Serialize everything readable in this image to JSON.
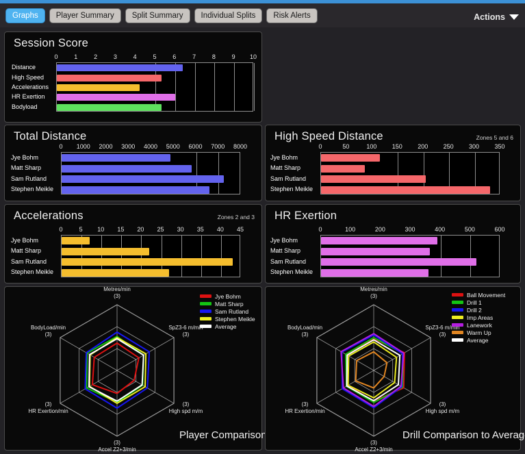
{
  "topbar": {
    "tabs": [
      {
        "label": "Graphs",
        "active": true
      },
      {
        "label": "Player Summary",
        "active": false
      },
      {
        "label": "Split Summary",
        "active": false
      },
      {
        "label": "Individual Splits",
        "active": false
      },
      {
        "label": "Risk Alerts",
        "active": false
      }
    ],
    "actions_label": "Actions",
    "caret_icon": "chevron-down-icon",
    "accent_color": "#4fb3f0",
    "strip_color": "#3c91d6"
  },
  "chart_data": [
    {
      "id": "session-score",
      "type": "bar",
      "orientation": "horizontal",
      "title": "Session Score",
      "subtitle": "",
      "categories": [
        "Distance",
        "High Speed",
        "Accelerations",
        "HR Exertion",
        "Bodyload"
      ],
      "values": [
        6.4,
        5.3,
        4.2,
        6.0,
        5.3
      ],
      "colors": [
        "#6363ee",
        "#f5676a",
        "#f5be2e",
        "#e06fe8",
        "#5ee05e"
      ],
      "xlim": [
        0,
        10
      ],
      "ticks": [
        0,
        1,
        2,
        3,
        4,
        5,
        6,
        7,
        8,
        9,
        10
      ],
      "gridlines": [
        5,
        6,
        7,
        8,
        9,
        10
      ],
      "xlabel": "",
      "ylabel": "",
      "grid": true,
      "legend": "none"
    },
    {
      "id": "total-distance",
      "type": "bar",
      "orientation": "horizontal",
      "title": "Total Distance",
      "subtitle": "",
      "categories": [
        "Jye Bohm",
        "Matt Sharp",
        "Sam Rutland",
        "Stephen Meikle"
      ],
      "values": [
        4850,
        5800,
        7250,
        6600
      ],
      "color": "#6363ee",
      "xlim": [
        0,
        8000
      ],
      "ticks": [
        0,
        1000,
        2000,
        3000,
        4000,
        5000,
        6000,
        7000,
        8000
      ],
      "gridlines": [
        6000,
        7000
      ],
      "xlabel": "",
      "ylabel": "",
      "grid": true,
      "legend": "none"
    },
    {
      "id": "high-speed-distance",
      "type": "bar",
      "orientation": "horizontal",
      "title": "High Speed Distance",
      "subtitle": "Zones 5 and 6",
      "categories": [
        "Jye Bohm",
        "Matt Sharp",
        "Sam Rutland",
        "Stephen Meikle"
      ],
      "values": [
        115,
        85,
        205,
        330
      ],
      "color": "#f5676a",
      "xlim": [
        0,
        350
      ],
      "ticks": [
        0,
        50,
        100,
        150,
        200,
        250,
        300,
        350
      ],
      "gridlines": [
        150,
        200,
        250,
        300
      ],
      "xlabel": "",
      "ylabel": "",
      "grid": true,
      "legend": "none"
    },
    {
      "id": "accelerations",
      "type": "bar",
      "orientation": "horizontal",
      "title": "Accelerations",
      "subtitle": "Zones 2 and 3",
      "categories": [
        "Jye Bohm",
        "Matt Sharp",
        "Sam Rutland",
        "Stephen Meikle"
      ],
      "values": [
        7,
        22,
        43,
        27
      ],
      "color": "#f5be2e",
      "xlim": [
        0,
        45
      ],
      "ticks": [
        0,
        5,
        10,
        15,
        20,
        25,
        30,
        35,
        40,
        45
      ],
      "gridlines": [
        5,
        10,
        15,
        20,
        25,
        30,
        35,
        40
      ],
      "xlabel": "",
      "ylabel": "",
      "grid": true,
      "legend": "none"
    },
    {
      "id": "hr-exertion",
      "type": "bar",
      "orientation": "horizontal",
      "title": "HR Exertion",
      "subtitle": "",
      "categories": [
        "Jye Bohm",
        "Matt Sharp",
        "Sam Rutland",
        "Stephen Meikle"
      ],
      "values": [
        390,
        365,
        520,
        360
      ],
      "color": "#e06fe8",
      "xlim": [
        0,
        600
      ],
      "ticks": [
        0,
        100,
        200,
        300,
        400,
        500,
        600
      ],
      "gridlines": [
        400,
        500
      ],
      "xlabel": "",
      "ylabel": "",
      "grid": true,
      "legend": "none"
    },
    {
      "id": "player-comparison",
      "type": "radar",
      "caption": "Player Comparison",
      "axes": [
        {
          "label": "Metres/min",
          "scale": "(3)"
        },
        {
          "label": "SpZ3-6 m/min",
          "scale": "(3)"
        },
        {
          "label": "High spd m/m",
          "scale": "(3)"
        },
        {
          "label": "Accel Z2+3/min",
          "scale": "(3)"
        },
        {
          "label": "HR Exertion/min",
          "scale": "(3)"
        },
        {
          "label": "BodyLoad/min",
          "scale": "(3)"
        }
      ],
      "rings": 3,
      "rmax": 3,
      "legend_position": "top-right",
      "series": [
        {
          "name": "Jye Bohm",
          "color": "#dd1111",
          "values": [
            1.25,
            1.15,
            0.9,
            1.05,
            1.3,
            1.2
          ]
        },
        {
          "name": "Matt Sharp",
          "color": "#13c413",
          "values": [
            1.55,
            1.4,
            1.35,
            1.45,
            1.6,
            1.58
          ]
        },
        {
          "name": "Sam Rutland",
          "color": "#1616ef",
          "values": [
            1.75,
            1.7,
            1.6,
            1.72,
            1.68,
            1.62
          ]
        },
        {
          "name": "Stephen Meikle",
          "color": "#eded22",
          "values": [
            1.5,
            1.52,
            1.48,
            1.5,
            1.45,
            1.42
          ]
        },
        {
          "name": "Average",
          "color": "#ffffff",
          "values": [
            1.45,
            1.4,
            1.32,
            1.4,
            1.48,
            1.45
          ]
        }
      ]
    },
    {
      "id": "drill-comparison",
      "type": "radar",
      "caption": "Drill Comparison to Average",
      "axes": [
        {
          "label": "Metres/min",
          "scale": "(3)"
        },
        {
          "label": "SpZ3-6 m/min",
          "scale": "(3)"
        },
        {
          "label": "High spd m/m",
          "scale": "(3)"
        },
        {
          "label": "Accel Z2+3/min",
          "scale": "(3)"
        },
        {
          "label": "HR Exertion/min",
          "scale": "(3)"
        },
        {
          "label": "BodyLoad/min",
          "scale": "(3)"
        }
      ],
      "rings": 3,
      "rmax": 3,
      "legend_position": "top-right",
      "series": [
        {
          "name": "Ball Movement",
          "color": "#dd1111",
          "values": [
            1.45,
            1.62,
            1.58,
            1.4,
            1.38,
            1.42
          ]
        },
        {
          "name": "Drill 1",
          "color": "#13c413",
          "values": [
            1.5,
            1.55,
            1.52,
            1.46,
            1.44,
            1.48
          ]
        },
        {
          "name": "Drill 2",
          "color": "#1616ef",
          "values": [
            1.62,
            1.52,
            1.48,
            1.7,
            1.66,
            1.68
          ]
        },
        {
          "name": "Imp Areas",
          "color": "#eded22",
          "values": [
            1.3,
            1.2,
            1.1,
            1.25,
            1.35,
            1.32
          ]
        },
        {
          "name": "Lanework",
          "color": "#b41ee0",
          "values": [
            1.68,
            1.58,
            1.44,
            1.64,
            1.6,
            1.72
          ]
        },
        {
          "name": "Warm Up",
          "color": "#e08522",
          "values": [
            0.85,
            0.7,
            0.55,
            0.8,
            0.95,
            0.9
          ]
        },
        {
          "name": "Average",
          "color": "#ffffff",
          "values": [
            1.4,
            1.38,
            1.3,
            1.38,
            1.42,
            1.4
          ]
        }
      ]
    }
  ]
}
